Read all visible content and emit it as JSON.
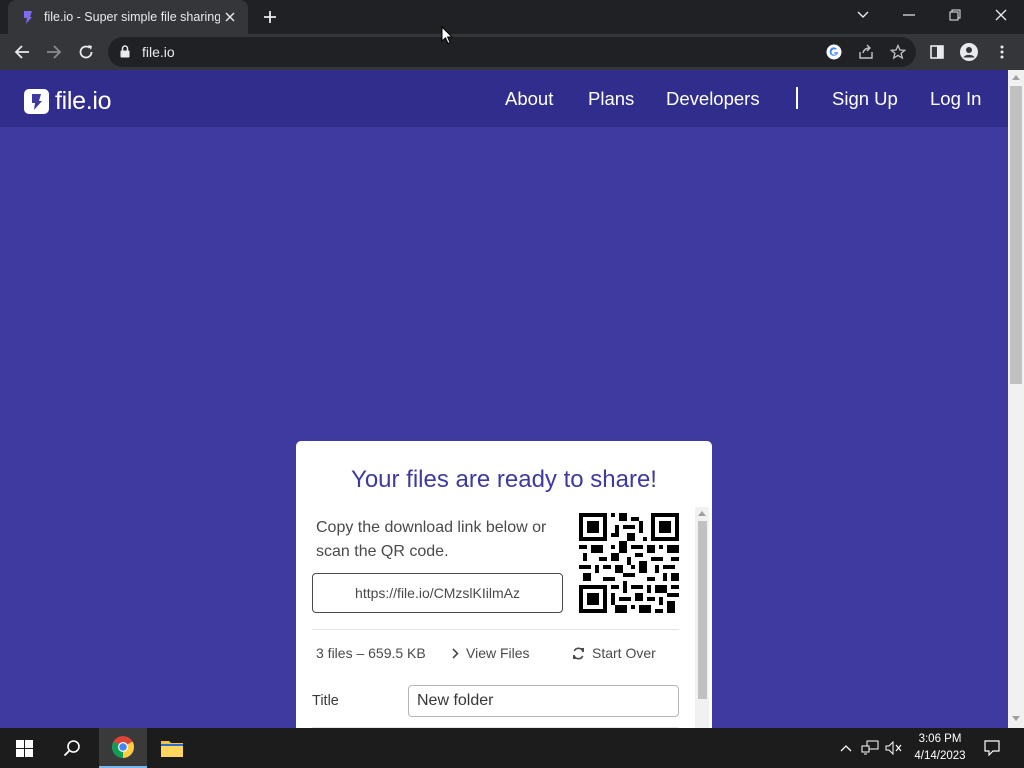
{
  "browser": {
    "tab_title": "file.io - Super simple file sharing",
    "url": "file.io"
  },
  "site": {
    "logo_text": "file.io",
    "nav": {
      "about": "About",
      "plans": "Plans",
      "developers": "Developers",
      "sign_up": "Sign Up",
      "log_in": "Log In"
    }
  },
  "card": {
    "heading": "Your files are ready to share!",
    "description": "Copy the download link below or scan the QR code.",
    "share_link": "https://file.io/CMzslKIilmAz",
    "file_summary": "3 files – 659.5 KB",
    "view_files": "View Files",
    "start_over": "Start Over",
    "title_label": "Title",
    "title_value": "New folder"
  },
  "taskbar": {
    "time": "3:06 PM",
    "date": "4/14/2023"
  },
  "colors": {
    "page_bg": "#3e3a9f",
    "nav_bg": "#312d8c",
    "heading": "#3e3a9f",
    "chrome_dark": "#202124",
    "chrome_mid": "#35363a"
  },
  "icons": [
    "chrome-icon",
    "file-explorer-icon",
    "windows-start-icon",
    "search-icon",
    "qr-code"
  ]
}
